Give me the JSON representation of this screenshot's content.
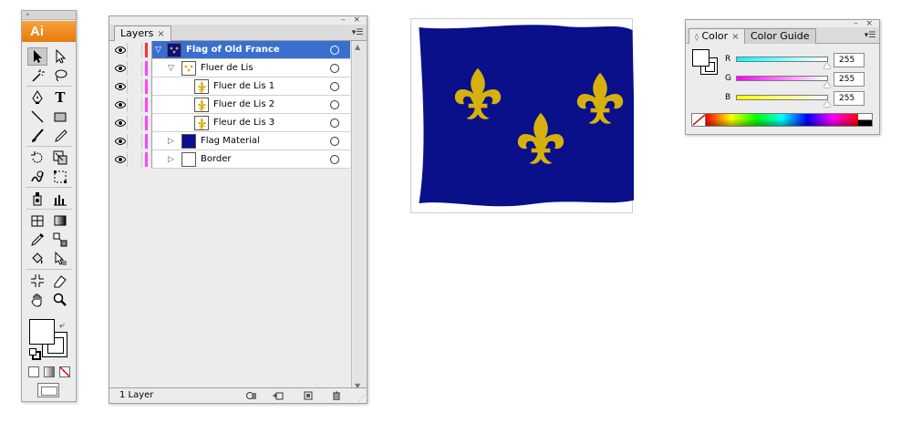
{
  "toolbox": {
    "logo": "Ai",
    "tools": [
      [
        "selection-tool",
        "direct-selection-tool"
      ],
      [
        "magic-wand-tool",
        "lasso-tool"
      ],
      [
        "pen-tool",
        "type-tool"
      ],
      [
        "line-segment-tool",
        "rectangle-tool"
      ],
      [
        "paintbrush-tool",
        "pencil-tool"
      ],
      [
        "rotate-tool",
        "scale-tool"
      ],
      [
        "warp-tool",
        "free-transform-tool"
      ],
      [
        "symbol-sprayer-tool",
        "column-graph-tool"
      ],
      [
        "mesh-tool",
        "gradient-tool"
      ],
      [
        "eyedropper-tool",
        "blend-tool"
      ],
      [
        "live-paint-bucket-tool",
        "live-paint-selection-tool"
      ],
      [
        "slice-tool",
        "eraser-tool"
      ],
      [
        "hand-tool",
        "zoom-tool"
      ]
    ],
    "type_glyph": "T"
  },
  "layers_panel": {
    "tab_label": "Layers",
    "tab_close": "×",
    "rows": [
      {
        "name": "Flag of Old France",
        "level": 0,
        "expanded": true,
        "selected": true,
        "color": "#ff3030",
        "thumb": "flag"
      },
      {
        "name": "Fluer de Lis",
        "level": 1,
        "expanded": true,
        "selected": false,
        "color": "#ff44ff",
        "thumb": "fleurs"
      },
      {
        "name": "Fluer de Lis 1",
        "level": 2,
        "expanded": false,
        "selected": false,
        "color": "#ff44ff",
        "thumb": "fleur"
      },
      {
        "name": "Fluer de Lis 2",
        "level": 2,
        "expanded": false,
        "selected": false,
        "color": "#ff44ff",
        "thumb": "fleur"
      },
      {
        "name": "Fleur de Lis 3",
        "level": 2,
        "expanded": false,
        "selected": false,
        "color": "#ff44ff",
        "thumb": "fleur"
      },
      {
        "name": "Flag Material",
        "level": 1,
        "expanded": false,
        "selected": false,
        "color": "#ff44ff",
        "thumb": "blue"
      },
      {
        "name": "Border",
        "level": 1,
        "expanded": false,
        "selected": false,
        "color": "#ff44ff",
        "thumb": "white"
      }
    ],
    "footer_count": "1 Layer"
  },
  "artwork": {
    "flag_color": "#0a0f8a",
    "fleur_color": "#d6b10e"
  },
  "color_panel": {
    "tabs": [
      "Color",
      "Color Guide"
    ],
    "active_tab": "Color",
    "tab_close": "×",
    "channels": [
      {
        "label": "R",
        "value": "255",
        "gradient_to": "#00ffff"
      },
      {
        "label": "G",
        "value": "255",
        "gradient_to": "#ff00ff"
      },
      {
        "label": "B",
        "value": "255",
        "gradient_to": "#ffff00"
      }
    ]
  }
}
